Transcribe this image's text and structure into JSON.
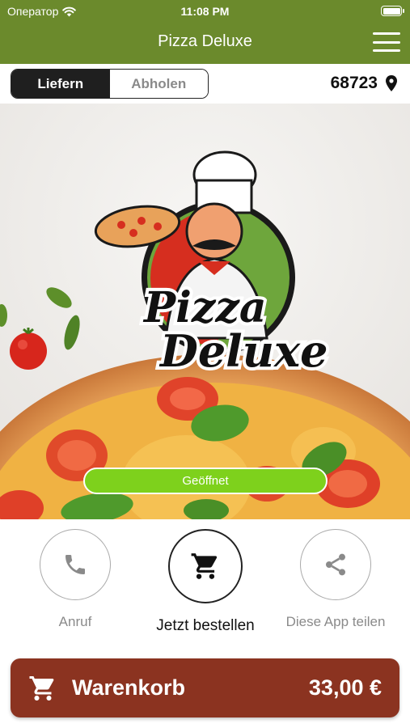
{
  "status_bar": {
    "carrier": "Оператор",
    "time": "11:08 PM"
  },
  "nav": {
    "title": "Pizza Deluxe"
  },
  "delivery_toggle": {
    "options": [
      "Liefern",
      "Abholen"
    ],
    "selected": "Liefern"
  },
  "location": {
    "zip": "68723"
  },
  "hero": {
    "logo_line1": "Pizza",
    "logo_line2": "Deluxe",
    "status_label": "Geöffnet"
  },
  "actions": {
    "call_label": "Anruf",
    "order_label": "Jetzt bestellen",
    "share_label": "Diese App teilen"
  },
  "cart": {
    "label": "Warenkorb",
    "total": "33,00 €"
  },
  "colors": {
    "header": "#6b8a2c",
    "open_badge": "#7ed11c",
    "cart_bar": "#8b3320"
  }
}
